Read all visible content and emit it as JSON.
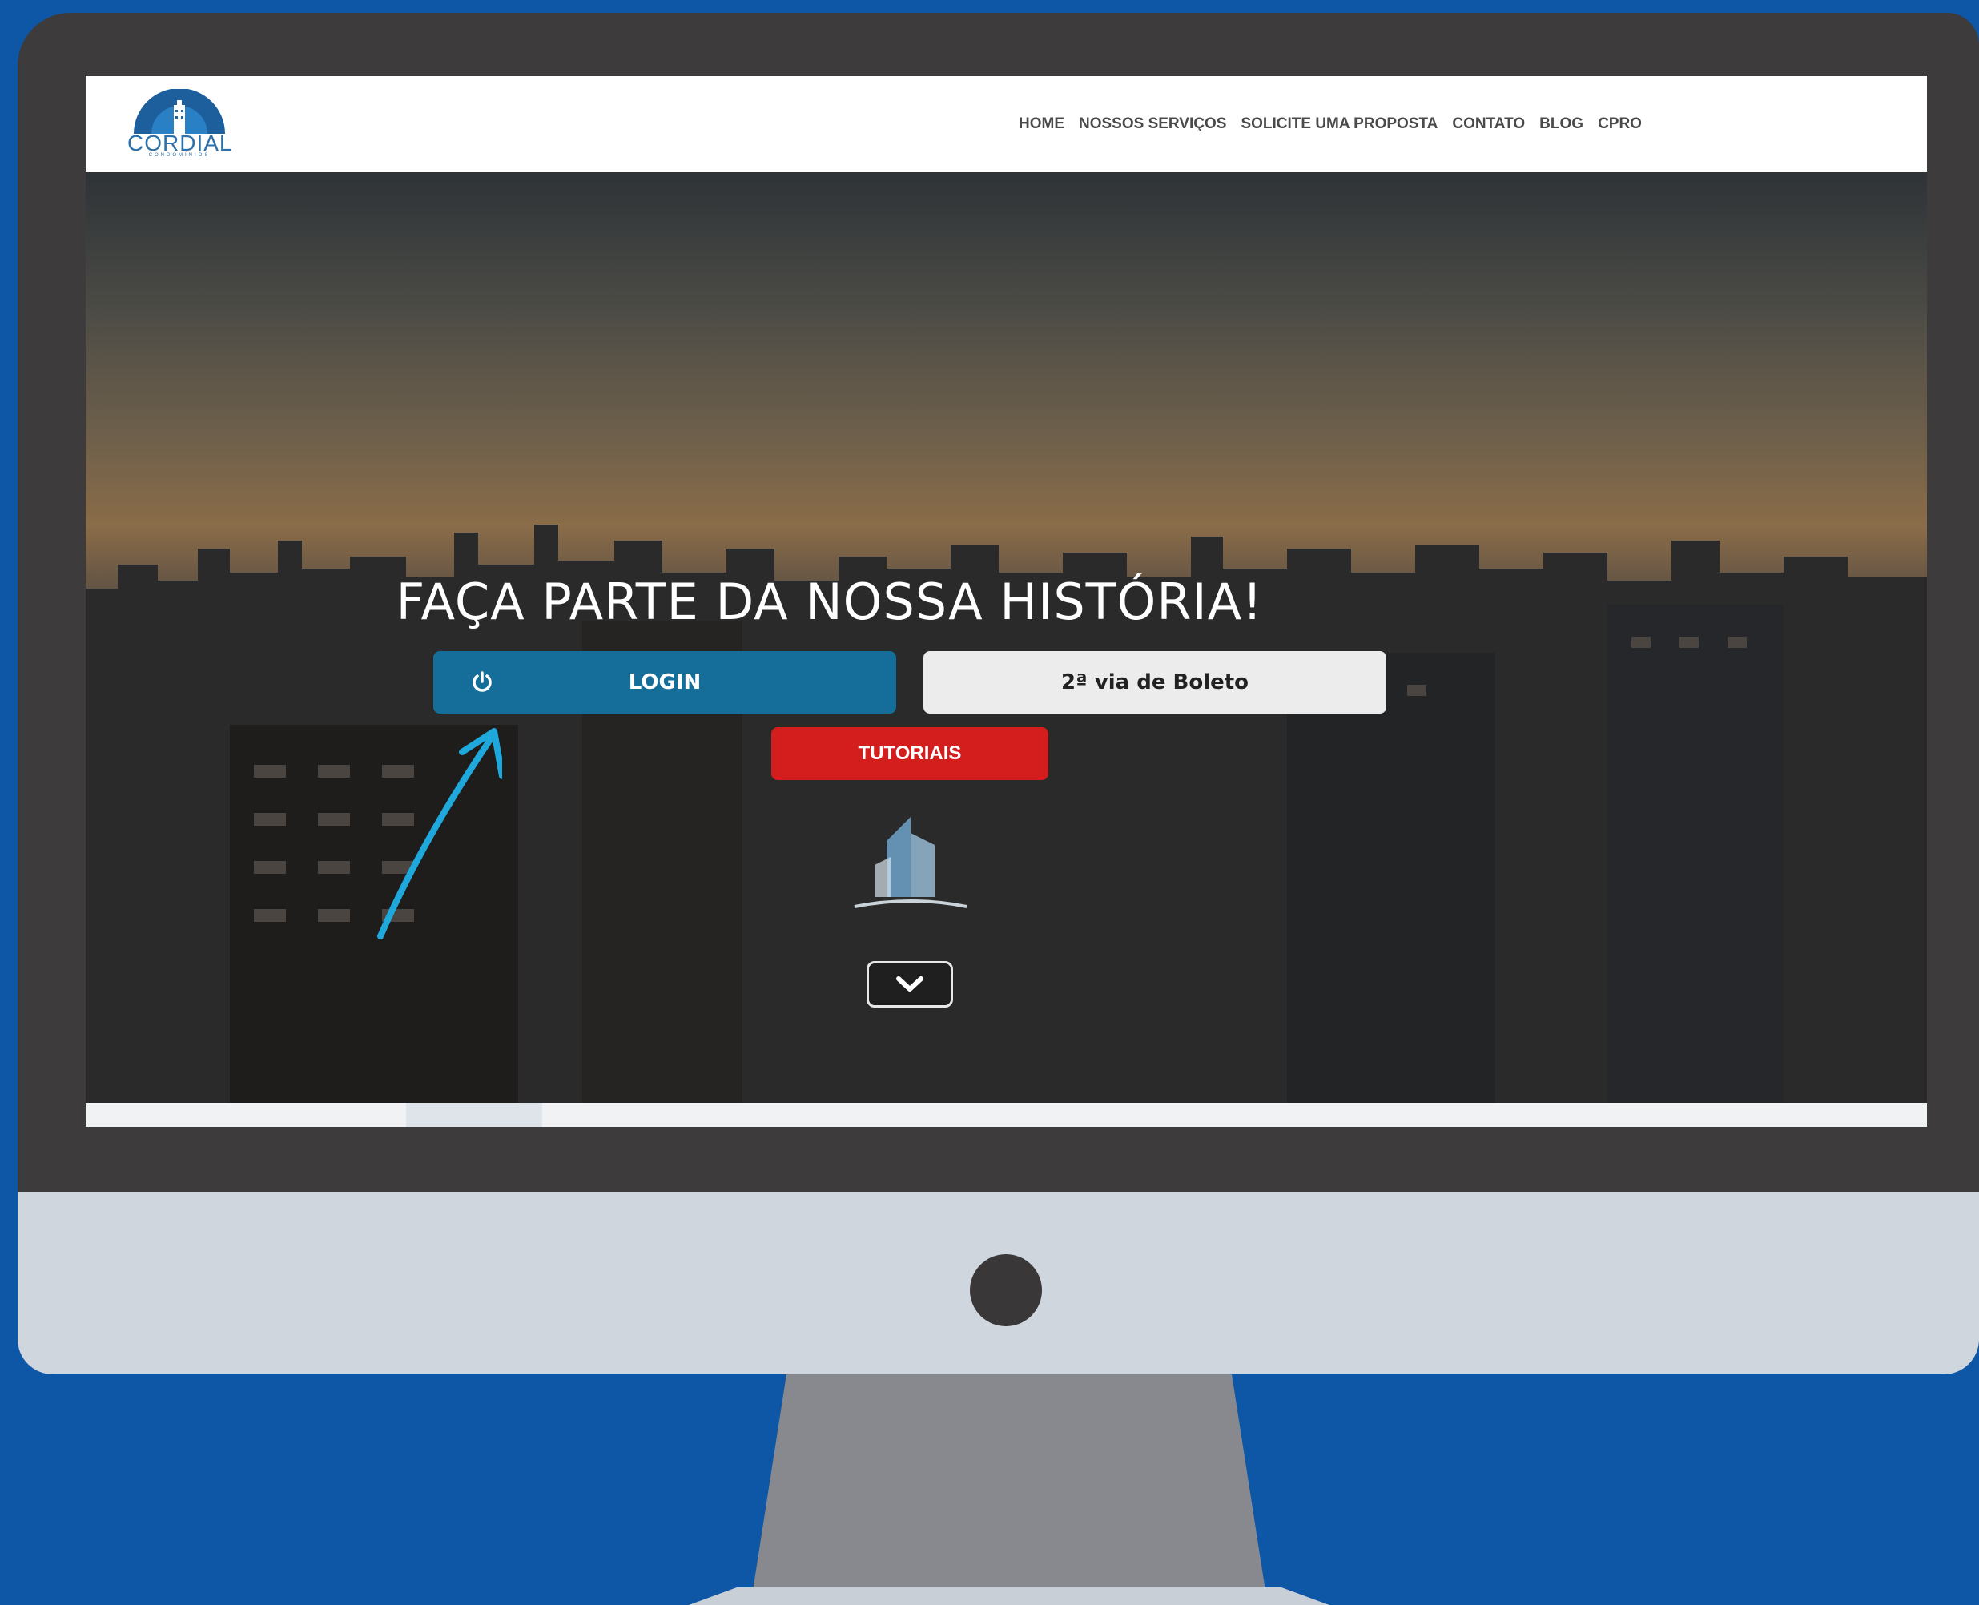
{
  "logo": {
    "name": "CORDIAL",
    "subtitle": "CONDOMÍNIOS"
  },
  "nav": {
    "items": [
      {
        "label": "HOME"
      },
      {
        "label": "NOSSOS SERVIÇOS"
      },
      {
        "label": "SOLICITE UMA PROPOSTA"
      },
      {
        "label": "CONTATO"
      },
      {
        "label": "BLOG"
      },
      {
        "label": "CPRO"
      }
    ]
  },
  "hero": {
    "title": "FAÇA PARTE DA NOSSA HISTÓRIA!",
    "login_label": "LOGIN",
    "boleto_label": "2ª via de Boleto",
    "tutoriais_label": "TUTORIAIS"
  },
  "icons": {
    "login": "power-icon",
    "scroll": "chevron-down-icon",
    "chat": "whatsapp-icon",
    "annotation": "arrow-icon"
  },
  "colors": {
    "background": "#0e56a6",
    "login_button": "#156d99",
    "boleto_button": "#ececec",
    "tutoriais_button": "#d41d1d",
    "whatsapp": "#25d366",
    "annotation_arrow": "#1fa8dc"
  }
}
